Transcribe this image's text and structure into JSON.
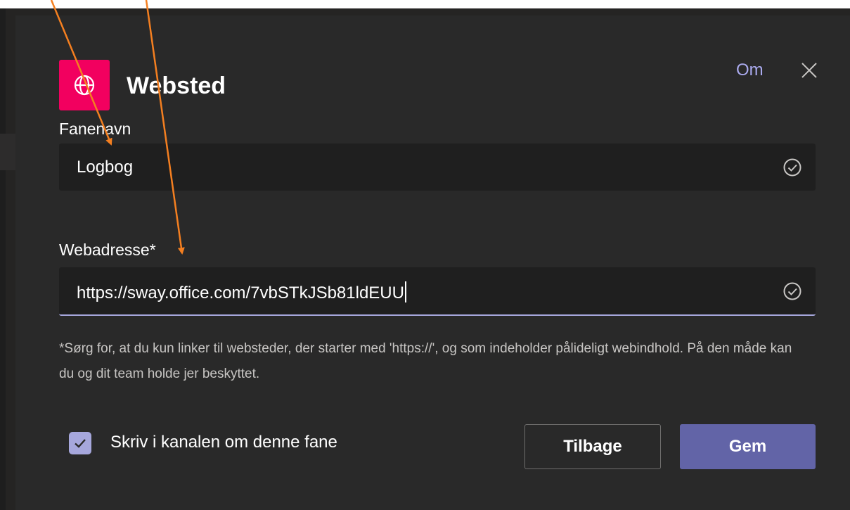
{
  "app": {
    "title": "Websted",
    "icon": "globe-icon",
    "icon_color": "#f2005f"
  },
  "header": {
    "about_label": "Om",
    "close_icon": "close-icon"
  },
  "tab_name": {
    "label": "Fanenavn",
    "value": "Logbog",
    "status_icon": "check-circle-icon"
  },
  "url": {
    "label": "Webadresse*",
    "value": "https://sway.office.com/7vbSTkJSb81ldEUU",
    "status_icon": "check-circle-icon"
  },
  "note": "*Sørg for, at du kun linker til websteder, der starter med 'https://', og som indeholder pålideligt webindhold. På den måde kan du og dit team holde jer beskyttet.",
  "post_to_channel": {
    "checked": true,
    "label": "Skriv i kanalen om denne fane"
  },
  "buttons": {
    "back_label": "Tilbage",
    "save_label": "Gem"
  },
  "colors": {
    "accent": "#6264a7",
    "accent_light": "#a6a7dc",
    "annotation_arrow": "#f47f20",
    "dialog_bg": "#292929"
  },
  "annotations": {
    "arrow_count": 2,
    "arrow_icon": "orange-arrow"
  }
}
